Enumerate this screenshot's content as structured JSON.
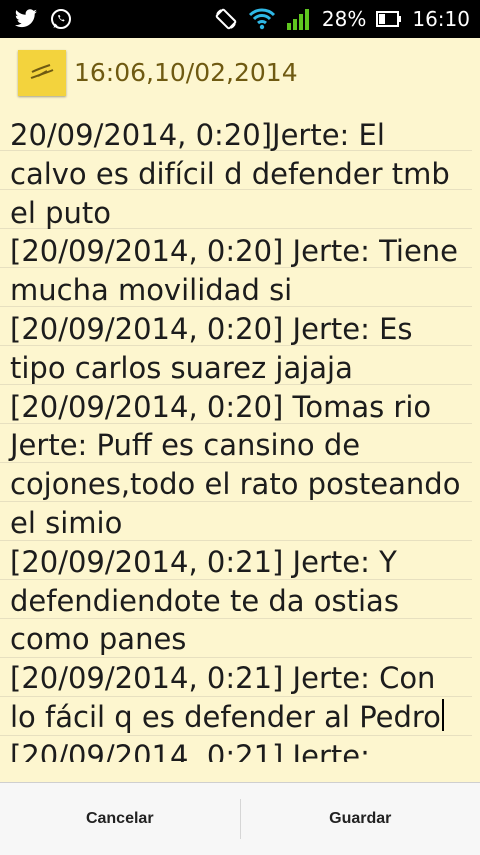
{
  "status_bar": {
    "battery_percent": "28%",
    "time": "16:10",
    "icons": [
      "twitter-icon",
      "whatsapp-icon",
      "screen-rotate-icon",
      "wifi-icon",
      "signal-icon",
      "battery-icon"
    ]
  },
  "note": {
    "title": "16:06,10/02,2014",
    "body": "20/09/2014, 0:20]Jerte: El\ncalvo es difícil d defender tmb\nel puto\n[20/09/2014, 0:20] Jerte: Tiene\nmucha movilidad si\n[20/09/2014, 0:20] Jerte: Es\ntipo carlos suarez jajaja\n[20/09/2014, 0:20] Tomas rio\nJerte: Puff es cansino de\ncojones,todo el rato posteando\nel simio\n[20/09/2014, 0:21] Jerte: Y\ndefendiendote te da ostias\ncomo panes\n[20/09/2014, 0:21] Jerte: Con\nlo fácil q es defender al Pedro",
    "body_tail": "[20/09/2014, 0:21] Jerte:"
  },
  "actions": {
    "cancel_label": "Cancelar",
    "save_label": "Guardar"
  },
  "colors": {
    "paper": "#fdf6cf",
    "title": "#6f5a12",
    "note_icon": "#f3d33d"
  }
}
